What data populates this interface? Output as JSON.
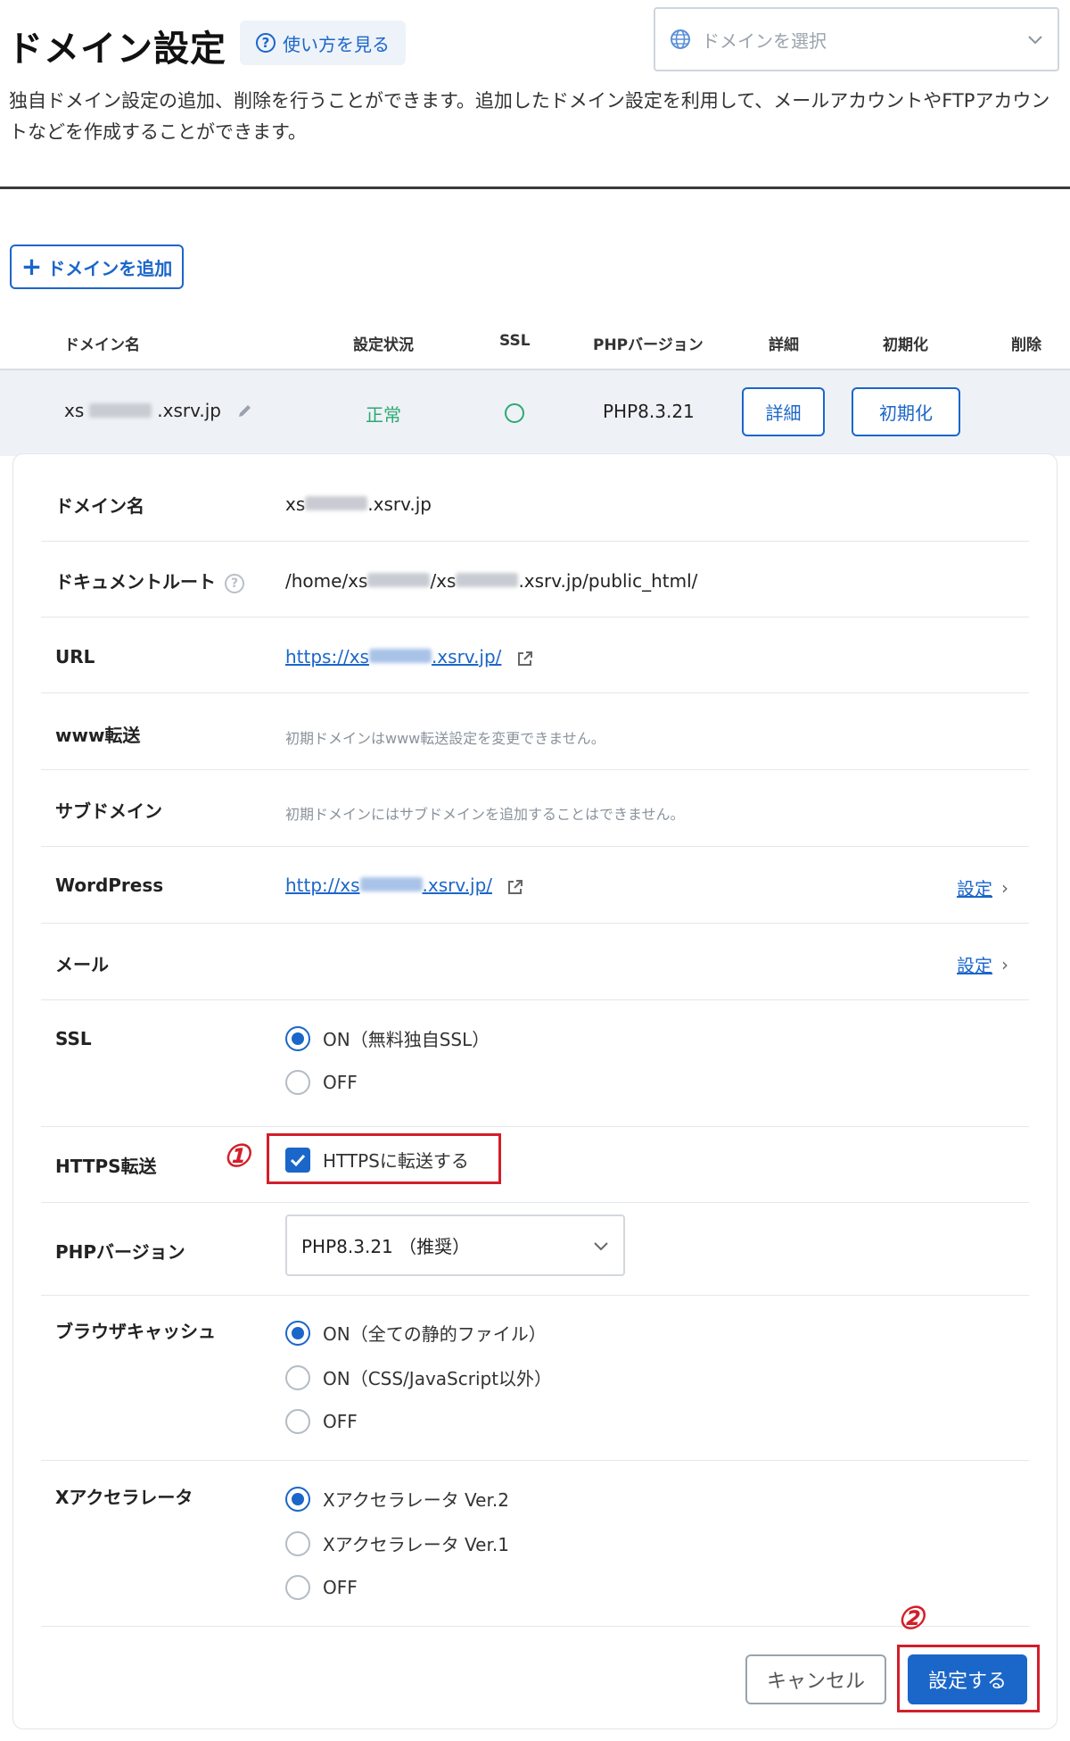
{
  "header": {
    "title": "ドメイン設定",
    "help_label": "使い方を見る",
    "domain_select_placeholder": "ドメインを選択",
    "description": "独自ドメイン設定の追加、削除を行うことができます。追加したドメイン設定を利用して、メールアカウントやFTPアカウントなどを作成することができます。"
  },
  "add_domain_label": "ドメインを追加",
  "table": {
    "columns": [
      "ドメイン名",
      "設定状況",
      "SSL",
      "PHPバージョン",
      "詳細",
      "初期化",
      "削除"
    ],
    "row": {
      "domain_prefix": "xs",
      "domain_suffix": ".xsrv.jp",
      "status": "正常",
      "php": "PHP8.3.21",
      "detail_label": "詳細",
      "init_label": "初期化"
    }
  },
  "detail": {
    "domain_label": "ドメイン名",
    "domain_prefix": "xs",
    "domain_suffix": ".xsrv.jp",
    "docroot_label": "ドキュメントルート",
    "docroot_p1": "/home/xs",
    "docroot_p2": "/xs",
    "docroot_p3": ".xsrv.jp/public_html/",
    "url_label": "URL",
    "url_prefix": "https://xs",
    "url_suffix": ".xsrv.jp/",
    "www_label": "www転送",
    "www_note": "初期ドメインはwww転送設定を変更できません。",
    "sub_label": "サブドメイン",
    "sub_note": "初期ドメインにはサブドメインを追加することはできません。",
    "wp_label": "WordPress",
    "wp_prefix": "http://xs",
    "wp_suffix": ".xsrv.jp/",
    "mail_label": "メール",
    "setting_link": "設定",
    "ssl_label": "SSL",
    "ssl_options": [
      "ON（無料独自SSL）",
      "OFF"
    ],
    "https_label": "HTTPS転送",
    "https_option": "HTTPSに転送する",
    "php_label": "PHPバージョン",
    "php_value": "PHP8.3.21 （推奨）",
    "cache_label": "ブラウザキャッシュ",
    "cache_options": [
      "ON（全ての静的ファイル）",
      "ON（CSS/JavaScript以外）",
      "OFF"
    ],
    "xacc_label": "Xアクセラレータ",
    "xacc_options": [
      "Xアクセラレータ Ver.2",
      "Xアクセラレータ Ver.1",
      "OFF"
    ]
  },
  "annotations": {
    "step1": "①",
    "step2": "②"
  },
  "buttons": {
    "cancel": "キャンセル",
    "submit": "設定する"
  },
  "colors": {
    "accent": "#1b66c9",
    "ok": "#2ea872",
    "highlight": "#d21f2a"
  }
}
